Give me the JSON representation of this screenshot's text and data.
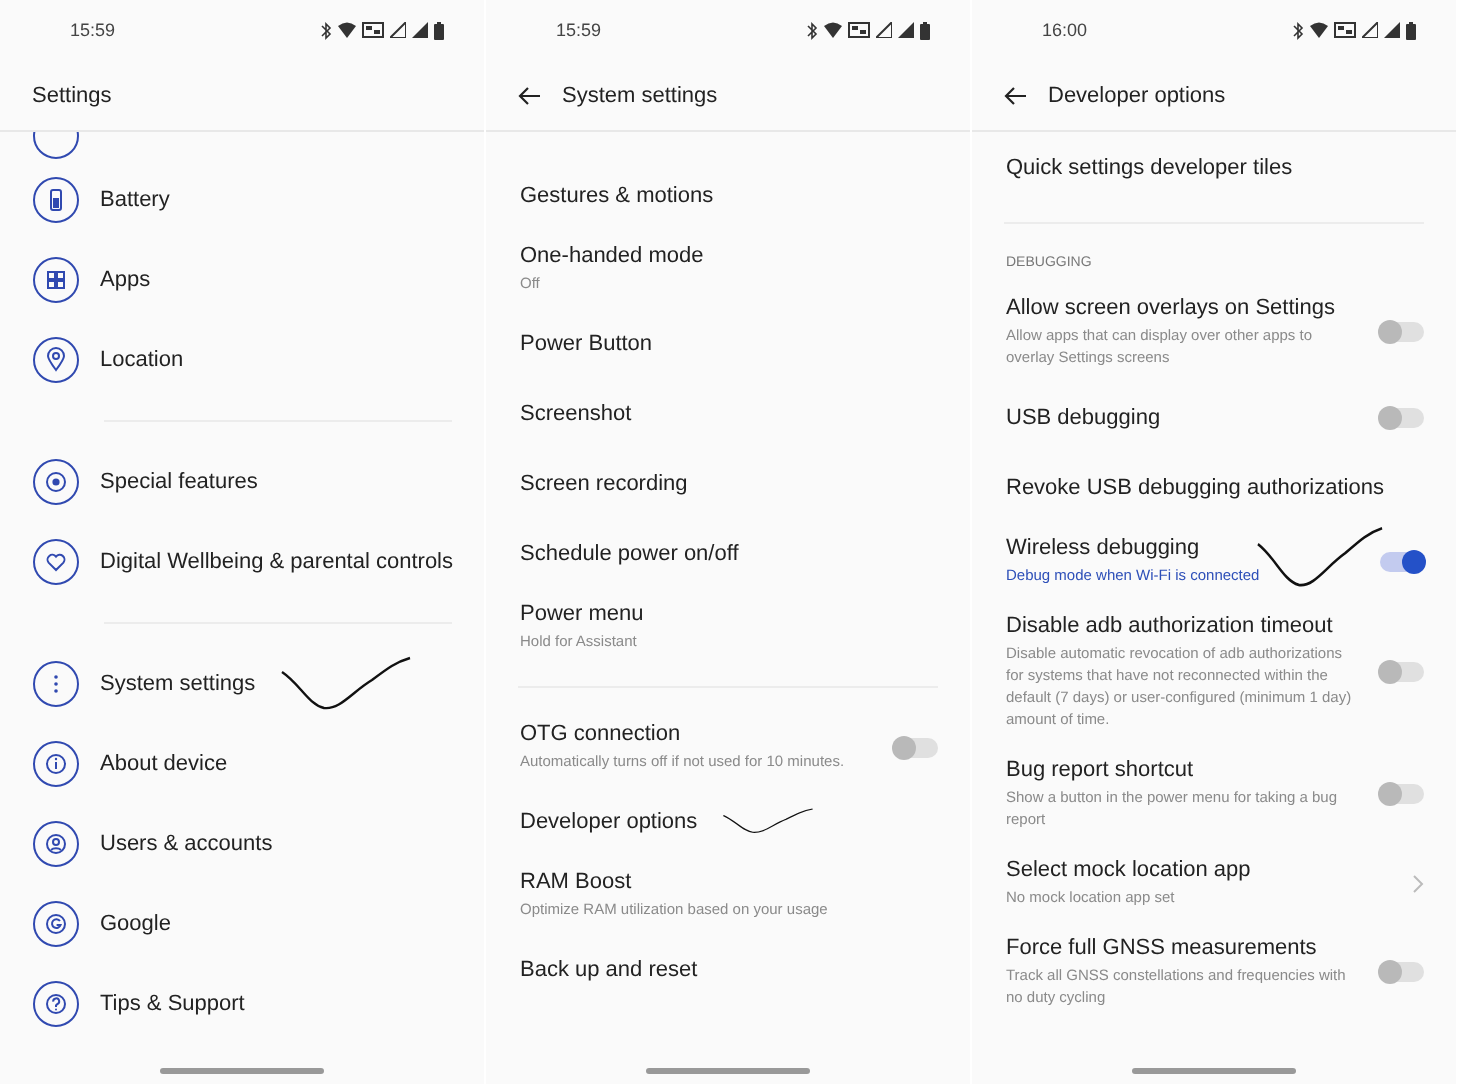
{
  "screens": [
    {
      "time": "15:59",
      "title": "Settings",
      "back": false,
      "items": [
        {
          "kind": "clipped"
        },
        {
          "kind": "nav",
          "label": "Battery",
          "marked": false
        },
        {
          "kind": "nav",
          "label": "Apps",
          "marked": false
        },
        {
          "kind": "nav",
          "label": "Location",
          "marked": false
        },
        {
          "kind": "divider"
        },
        {
          "kind": "nav",
          "label": "Special features",
          "marked": false
        },
        {
          "kind": "nav",
          "label": "Digital Wellbeing & parental controls",
          "marked": false
        },
        {
          "kind": "divider"
        },
        {
          "kind": "nav",
          "label": "System settings",
          "marked": true
        },
        {
          "kind": "nav",
          "label": "About device",
          "marked": false
        },
        {
          "kind": "nav",
          "label": "Users & accounts",
          "marked": false
        },
        {
          "kind": "nav",
          "label": "Google",
          "marked": false
        },
        {
          "kind": "nav",
          "label": "Tips & Support",
          "marked": false
        }
      ]
    },
    {
      "time": "15:59",
      "title": "System settings",
      "back": true,
      "items": [
        {
          "kind": "spacer"
        },
        {
          "kind": "row",
          "label": "Gestures & motions",
          "marked": false
        },
        {
          "kind": "row",
          "label": "One-handed mode",
          "sub": "Off",
          "marked": false
        },
        {
          "kind": "row",
          "label": "Power Button",
          "marked": false
        },
        {
          "kind": "row",
          "label": "Screenshot",
          "marked": false
        },
        {
          "kind": "row",
          "label": "Screen recording",
          "marked": false
        },
        {
          "kind": "row",
          "label": "Schedule power on/off",
          "marked": false
        },
        {
          "kind": "row",
          "label": "Power menu",
          "sub": "Hold for Assistant",
          "marked": false
        },
        {
          "kind": "divider"
        },
        {
          "kind": "row",
          "label": "OTG connection",
          "sub": "Automatically turns off if not used for 10 minutes.",
          "switch": {
            "on": false
          },
          "marked": false
        },
        {
          "kind": "row",
          "label": "Developer options",
          "marked": true
        },
        {
          "kind": "row",
          "label": "RAM Boost",
          "sub": "Optimize RAM utilization based on your usage",
          "marked": false
        },
        {
          "kind": "row",
          "label": "Back up and reset",
          "marked": false
        }
      ]
    },
    {
      "time": "16:00",
      "title": "Developer options",
      "back": true,
      "items": [
        {
          "kind": "row",
          "label": "Quick settings developer tiles",
          "marked": false
        },
        {
          "kind": "divider"
        },
        {
          "kind": "header",
          "label": "DEBUGGING"
        },
        {
          "kind": "row",
          "label": "Allow screen overlays on Settings",
          "sub": "Allow apps that can display over other apps to overlay Settings screens",
          "switch": {
            "on": false
          },
          "marked": false
        },
        {
          "kind": "row",
          "label": "USB debugging",
          "switch": {
            "on": false
          },
          "marked": false
        },
        {
          "kind": "row",
          "label": "Revoke USB debugging authorizations",
          "marked": false
        },
        {
          "kind": "row",
          "label": "Wireless debugging",
          "sub": "Debug mode when Wi-Fi is connected",
          "color": "#2d4fb8",
          "switch": {
            "on": true
          },
          "marked": true
        },
        {
          "kind": "row",
          "label": "Disable adb authorization timeout",
          "sub": "Disable automatic revocation of adb authorizations for systems that have not reconnected within the default (7 days) or user-configured (minimum 1 day) amount of time.",
          "switch": {
            "on": false
          },
          "marked": false
        },
        {
          "kind": "row",
          "label": "Bug report shortcut",
          "sub": "Show a button in the power menu for taking a bug report",
          "switch": {
            "on": false
          },
          "marked": false
        },
        {
          "kind": "row",
          "label": "Select mock location app",
          "sub": "No mock location app set",
          "chevron": true,
          "marked": false
        },
        {
          "kind": "row",
          "label": "Force full GNSS measurements",
          "sub": "Track all GNSS constellations and frequencies with no duty cycling",
          "switch": {
            "on": false
          },
          "marked": false
        }
      ]
    }
  ]
}
